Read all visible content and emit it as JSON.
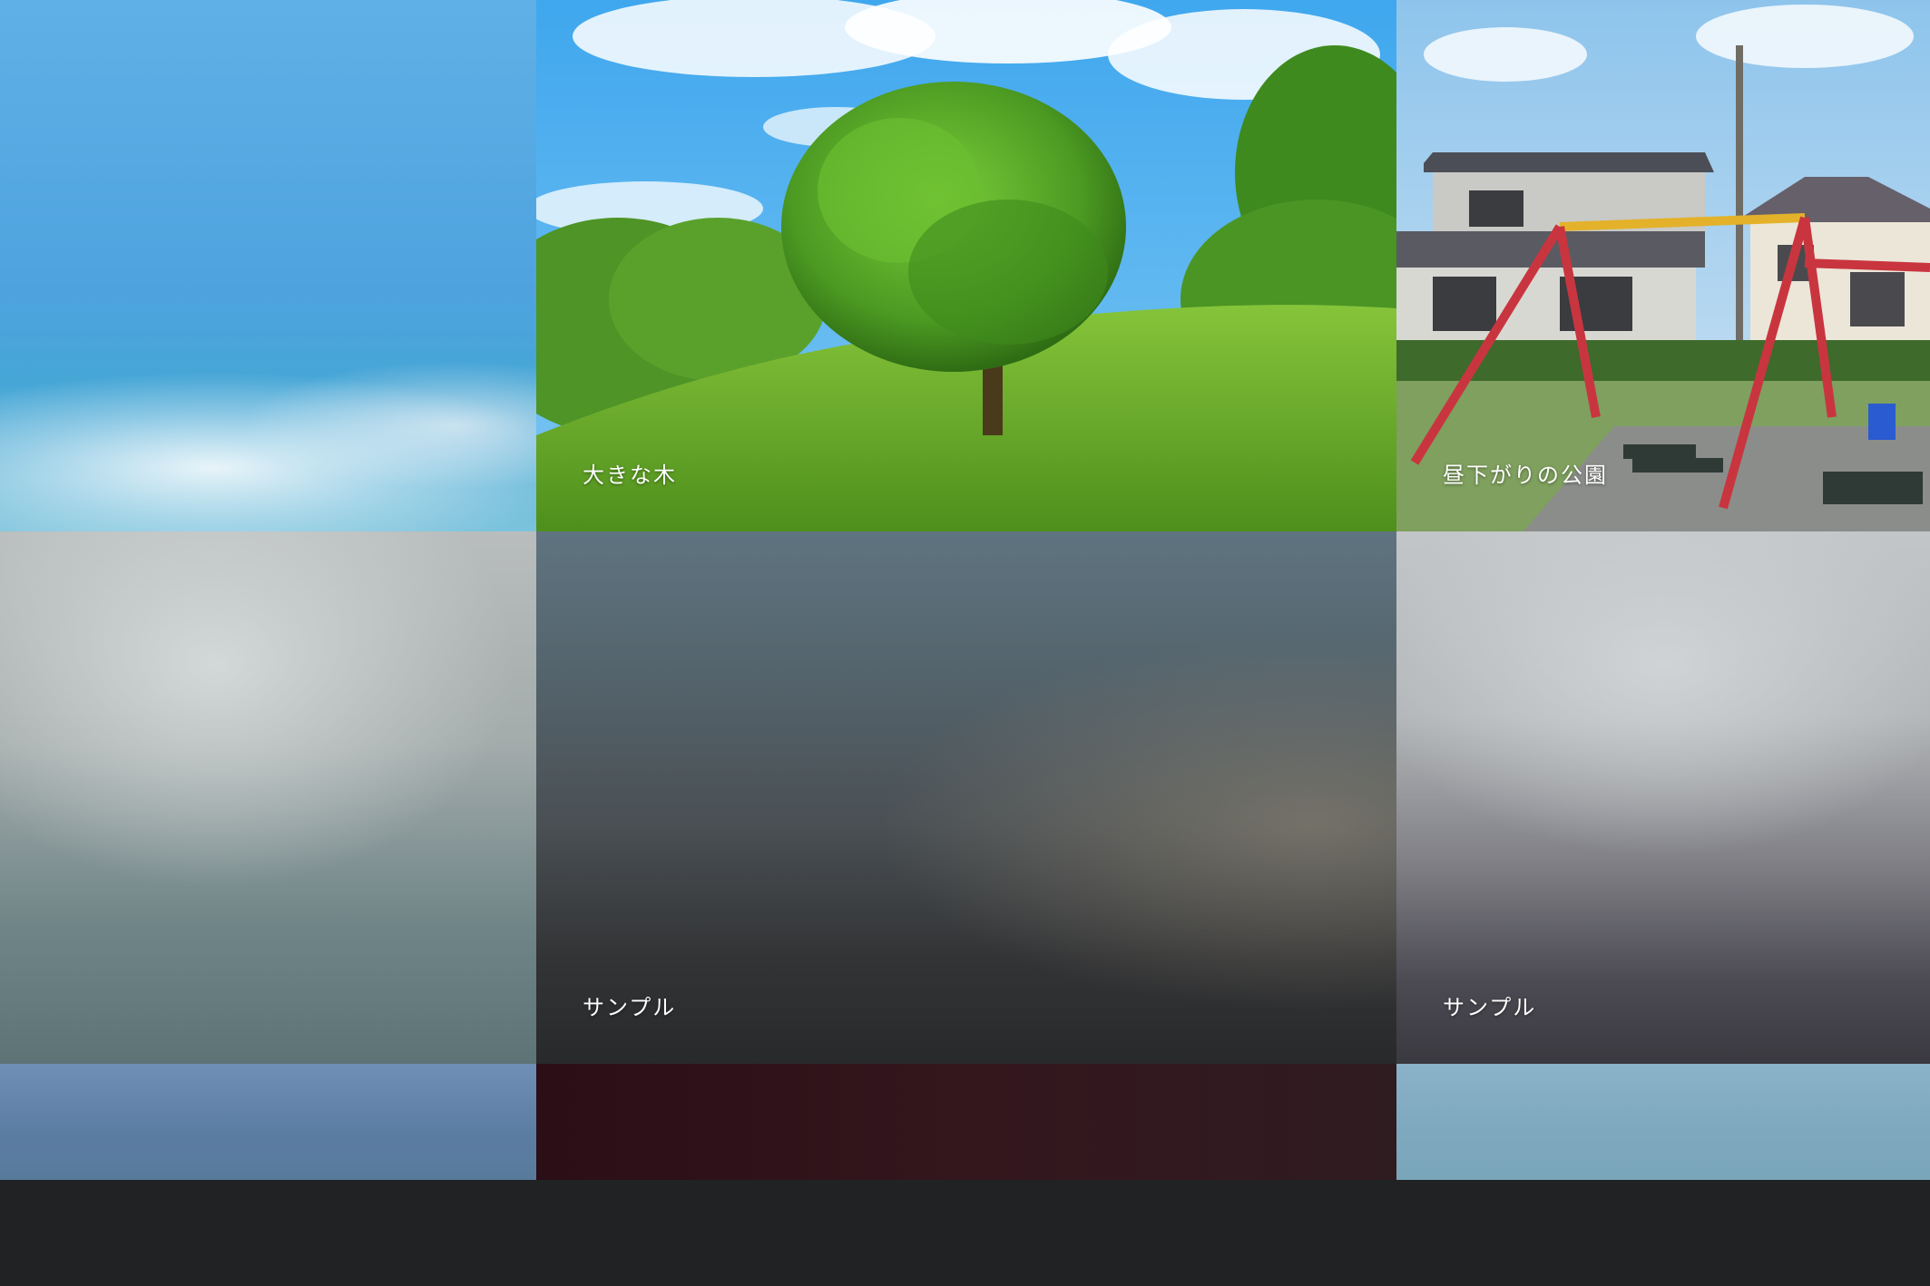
{
  "gallery": {
    "items": [
      {
        "id": "sky",
        "caption": ""
      },
      {
        "id": "big-tree",
        "caption": "大きな木"
      },
      {
        "id": "park",
        "caption": "昼下がりの公園"
      },
      {
        "id": "gray-a",
        "caption": ""
      },
      {
        "id": "sample-1",
        "caption": "サンプル"
      },
      {
        "id": "sample-2",
        "caption": "サンプル"
      },
      {
        "id": "blue-strip",
        "caption": ""
      },
      {
        "id": "maroon-strip",
        "caption": ""
      },
      {
        "id": "teal-strip",
        "caption": ""
      }
    ]
  },
  "colors": {
    "page_background": "#212224",
    "caption_text": "#ffffff"
  }
}
